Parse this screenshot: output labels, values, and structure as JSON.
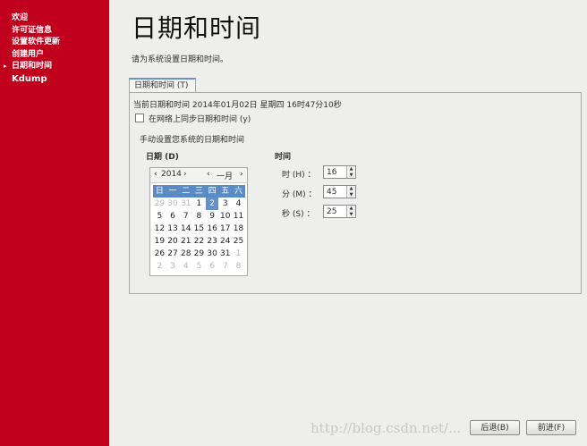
{
  "sidebar": {
    "items": [
      "欢迎",
      "许可证信息",
      "设置软件更新",
      "创建用户",
      "日期和时间",
      "Kdump"
    ],
    "active_index": 4
  },
  "page": {
    "title": "日期和时间",
    "subtitle": "请为系统设置日期和时间。"
  },
  "tab": {
    "label": "日期和时间 (T)"
  },
  "current": "当前日期和时间   2014年01月02日  星期四  16时47分10秒",
  "ntp_label": "在网络上同步日期和时间 (y)",
  "manual_label": "手动设置您系统的日期和时间",
  "date_label": "日期 (D)",
  "time_label": "时间",
  "calendar": {
    "year": "2014",
    "month": "一月",
    "weekdays": [
      "日",
      "一",
      "二",
      "三",
      "四",
      "五",
      "六"
    ],
    "weeks": [
      [
        "29",
        "30",
        "31",
        "1",
        "2",
        "3",
        "4"
      ],
      [
        "5",
        "6",
        "7",
        "8",
        "9",
        "10",
        "11"
      ],
      [
        "12",
        "13",
        "14",
        "15",
        "16",
        "17",
        "18"
      ],
      [
        "19",
        "20",
        "21",
        "22",
        "23",
        "24",
        "25"
      ],
      [
        "26",
        "27",
        "28",
        "29",
        "30",
        "31",
        "1"
      ],
      [
        "2",
        "3",
        "4",
        "5",
        "6",
        "7",
        "8"
      ]
    ],
    "selected": "2"
  },
  "time": {
    "hour_label": "时 (H) ：",
    "hour": "16",
    "minute_label": "分 (M) ：",
    "minute": "45",
    "second_label": "秒 (S) ：",
    "second": "25"
  },
  "buttons": {
    "back": "后退(B)",
    "forward": "前进(F)"
  },
  "watermark": "http://blog.csdn.net/...",
  "colors": {
    "sidebar": "#c0001c",
    "accent": "#5b8bc4"
  }
}
